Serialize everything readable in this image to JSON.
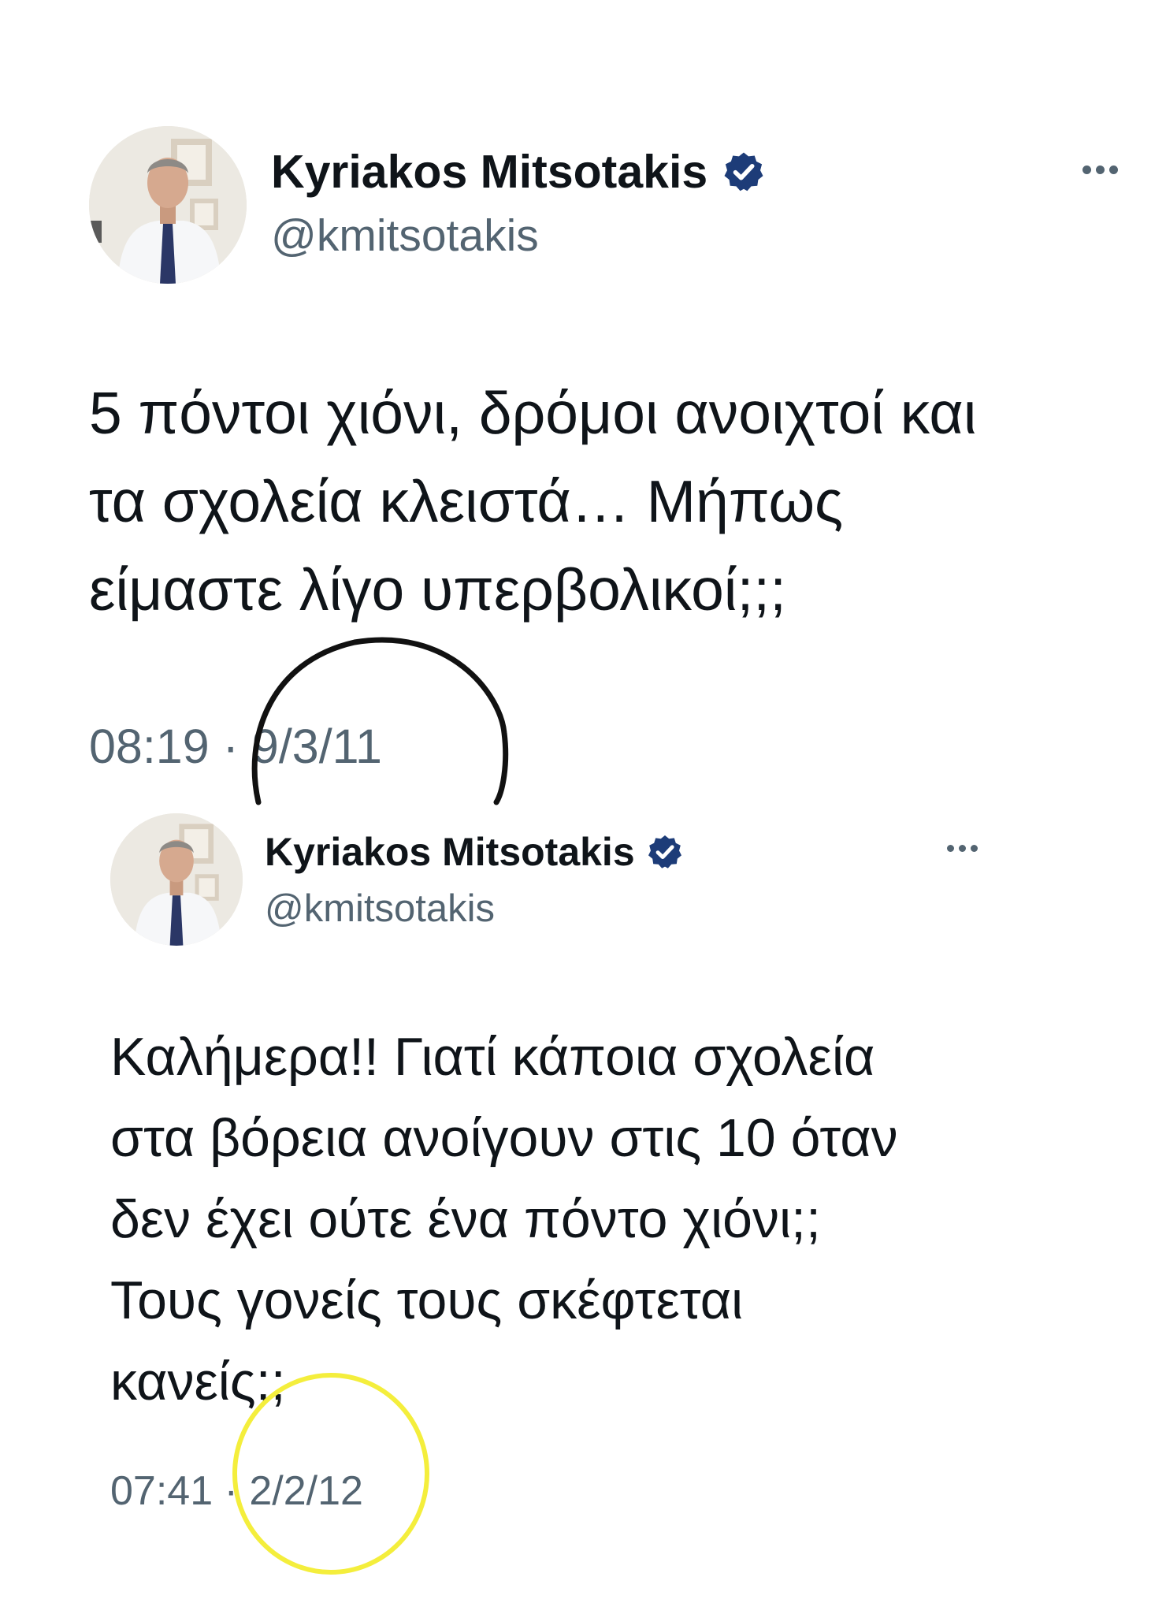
{
  "tweets": [
    {
      "author_name": "Kyriakos Mitsotakis",
      "handle": "@kmitsotakis",
      "verified_icon": "verified-badge-icon",
      "more_icon": "more-options-icon",
      "text": "5 πόντοι χιόνι, δρόμοι ανοιχτοί και\nτα σχολεία κλειστά… Μήπως\nείμαστε λίγο υπερβολικοί;;;",
      "time": "08:19",
      "separator": "·",
      "date": "9/3/11"
    },
    {
      "author_name": "Kyriakos Mitsotakis",
      "handle": "@kmitsotakis",
      "verified_icon": "verified-badge-icon",
      "more_icon": "more-options-icon",
      "text": "Καλήμερα!! Γιατί κάποια σχολεία\nστα βόρεια ανοίγουν στις 10 όταν\nδεν έχει ούτε ένα πόντο χιόνι;;\nΤους γονείς τους σκέφτεται\nκανείς;;",
      "time": "07:41",
      "separator": "·",
      "date": "2/2/12"
    }
  ],
  "colors": {
    "text": "#0f1419",
    "secondary_text": "#536471",
    "verified_badge": "#1d3c78",
    "annotation_black": "#111111",
    "annotation_yellow": "#f4ee3c"
  }
}
